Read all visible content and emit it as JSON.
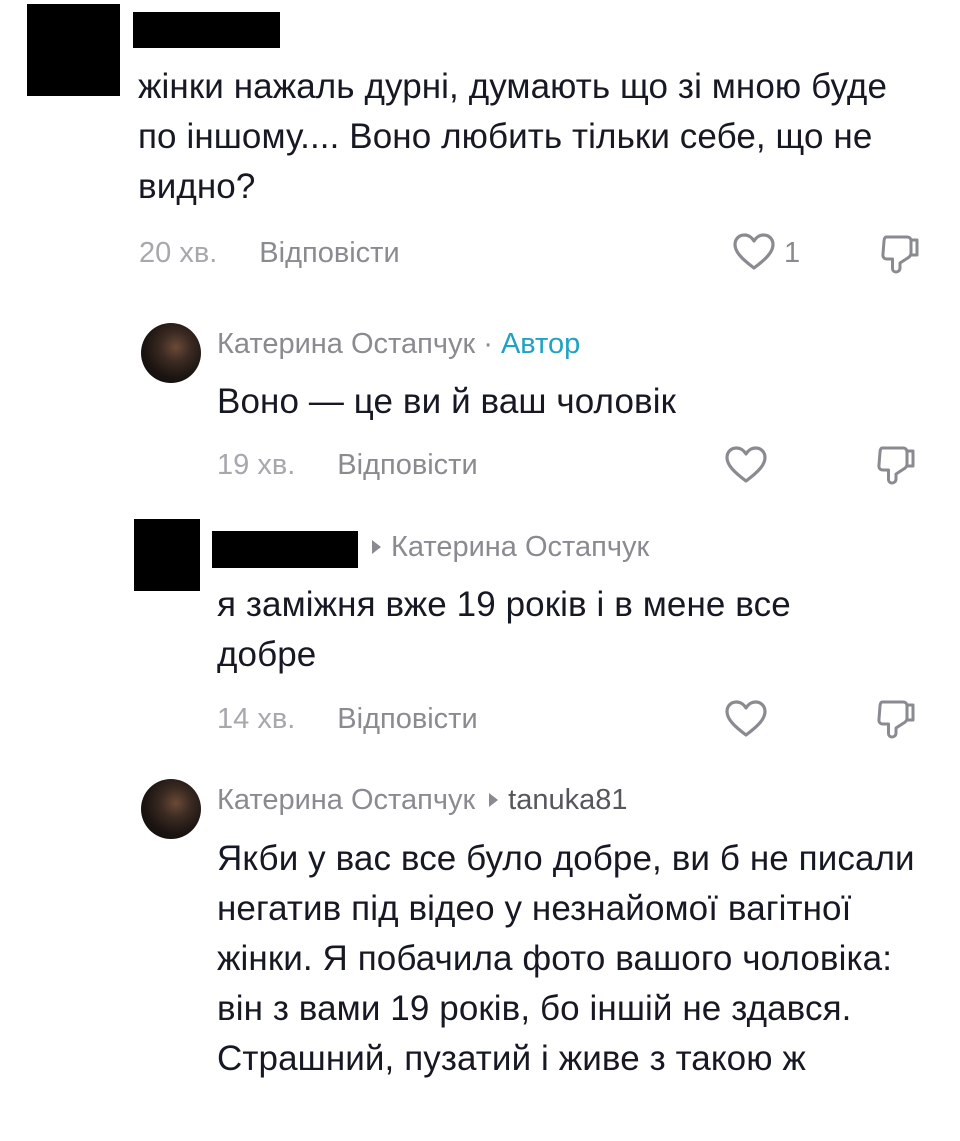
{
  "comments": [
    {
      "text": "жінки нажаль дурні, думають що зі мною буде по іншому.... Воно любить тільки себе, що не видно?",
      "time": "20 хв.",
      "reply": "Відповісти",
      "likes": "1"
    },
    {
      "author": "Катерина Остапчук",
      "separator": "·",
      "author_tag": "Автор",
      "text": "Воно — це ви й ваш чоловік",
      "time": "19 хв.",
      "reply": "Відповісти"
    },
    {
      "reply_to": "Катерина Остапчук",
      "text": "я заміжня вже 19 років і в мене все добре",
      "time": "14 хв.",
      "reply": "Відповісти"
    },
    {
      "author": "Катерина Остапчук",
      "reply_to": "tanuka81",
      "text": "Якби у вас все було добре, ви б не писали негатив під відео у незнайомої вагітної жінки. Я побачила фото вашого чоловіка: він з вами 19 років, бо іншій не здався. Страшний, пузатий і живе з такою ж"
    }
  ],
  "icons": {
    "like": "heart-outline-icon",
    "dislike": "thumbs-down-outline-icon"
  },
  "colors": {
    "text": "#161823",
    "meta": "#8a8b91",
    "author_tag": "#20a3c3",
    "redaction": "#000000"
  }
}
